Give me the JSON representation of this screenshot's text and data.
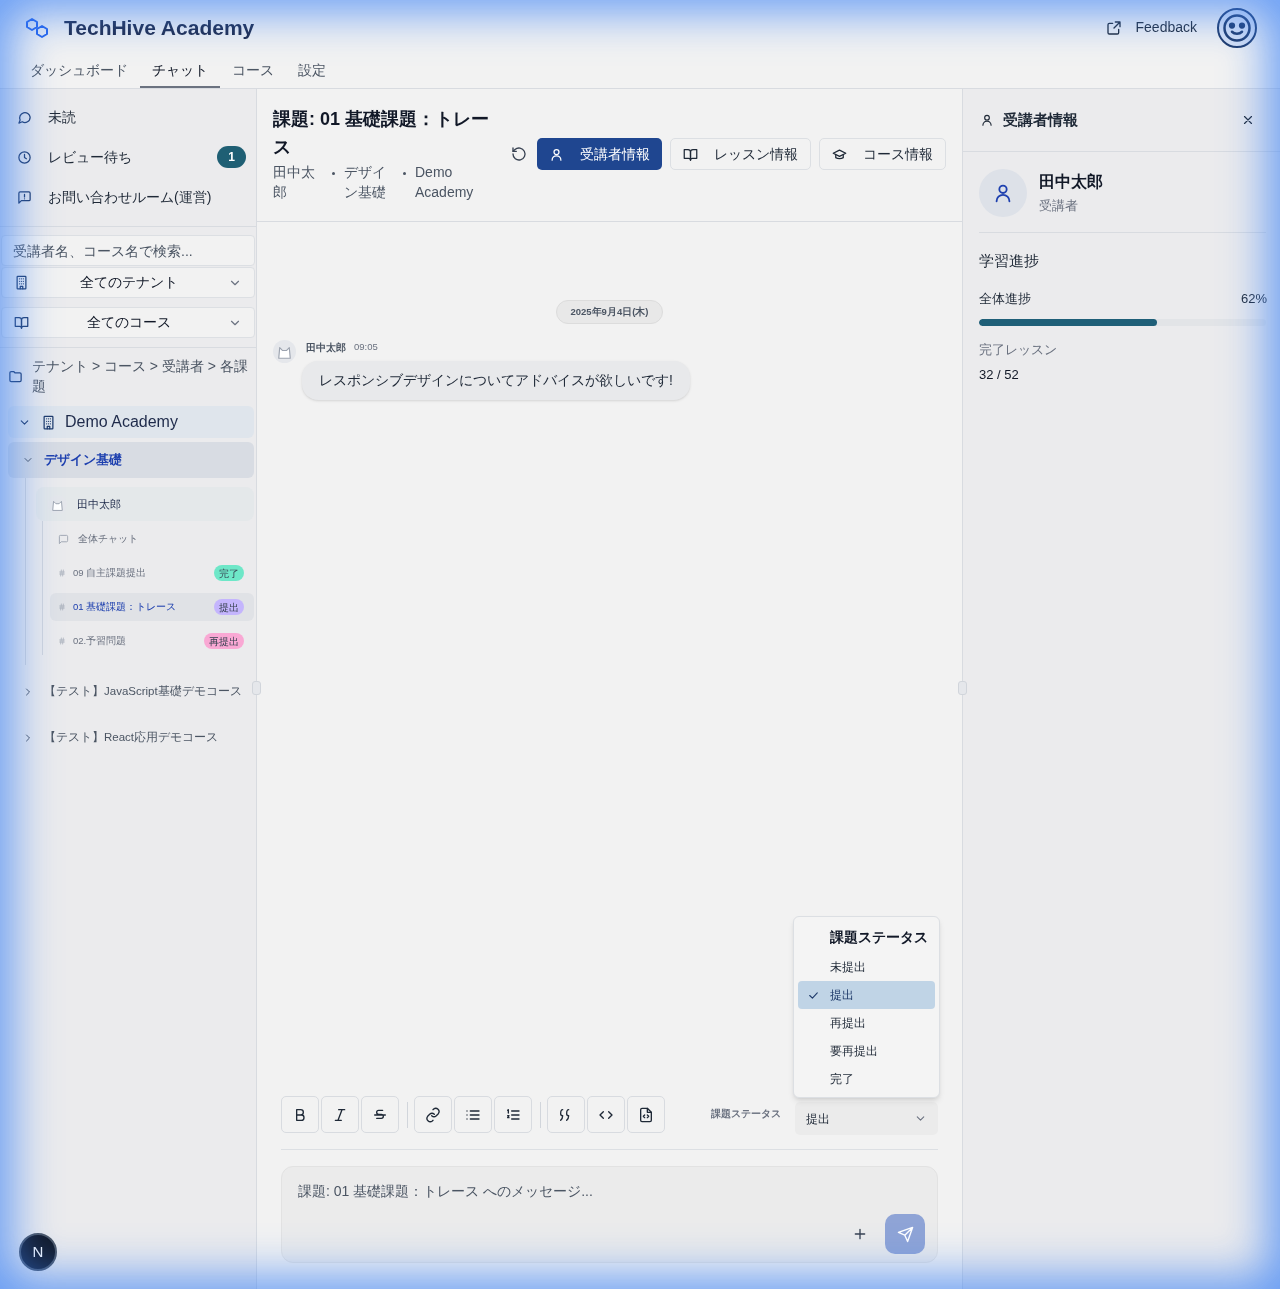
{
  "app": {
    "title": "TechHive Academy",
    "feedback": "Feedback",
    "dev_badge": "N"
  },
  "nav_tabs": [
    {
      "label": "ダッシュボード",
      "selected": false
    },
    {
      "label": "チャット",
      "selected": true
    },
    {
      "label": "コース",
      "selected": false
    },
    {
      "label": "設定",
      "selected": false
    }
  ],
  "sidebar": {
    "quick_links": [
      {
        "kind": "unread",
        "label": "未読"
      },
      {
        "kind": "review",
        "label": "レビュー待ち",
        "badge": "1"
      },
      {
        "kind": "inquiry",
        "label": "お問い合わせルーム(運営)"
      }
    ],
    "search": {
      "placeholder": "受講者名、コース名で検索..."
    },
    "filters": [
      {
        "kind": "tenant",
        "value": "全てのテナント"
      },
      {
        "kind": "course",
        "value": "全てのコース"
      }
    ],
    "tree_caption": "テナント > コース > 受講者 > 各課題",
    "tree": [
      {
        "label": "Demo Academy",
        "expanded": true,
        "children": [
          {
            "label": "デザイン基礎",
            "expanded": true,
            "selected": true,
            "children": [
              {
                "label": "田中太郎",
                "children": [
                  {
                    "kind": "chat",
                    "label": "全体チャット",
                    "selected": false
                  },
                  {
                    "kind": "assignment",
                    "label": "09 自主課題提出",
                    "status": "完了",
                    "color": "#6ee7c8",
                    "selected": false
                  },
                  {
                    "kind": "assignment",
                    "label": "01 基礎課題：トレース",
                    "status": "提出",
                    "color": "#c4b5fd",
                    "selected": true
                  },
                  {
                    "kind": "assignment",
                    "label": "02.予習問題",
                    "status": "再提出",
                    "color": "#f9a8d4",
                    "selected": false
                  }
                ]
              }
            ]
          },
          {
            "label": "【テスト】JavaScript基礎デモコース",
            "expanded": false,
            "selected": false
          },
          {
            "label": "【テスト】React応用デモコース",
            "expanded": false,
            "selected": false
          }
        ]
      }
    ]
  },
  "chat": {
    "title": "課題: 01 基礎課題：トレース",
    "meta": [
      "田中太郎",
      "デザイン基礎",
      "Demo Academy"
    ],
    "actions": [
      {
        "kind": "student",
        "label": "受講者情報",
        "selected": true
      },
      {
        "kind": "lesson",
        "label": "レッスン情報",
        "selected": false
      },
      {
        "kind": "course",
        "label": "コース情報",
        "selected": false
      }
    ],
    "date_divider": "2025年9月4日(木)",
    "messages": [
      {
        "author": "田中太郎",
        "time": "09:05",
        "text": "レスポンシブデザインについてアドバイスが欲しいです!"
      }
    ],
    "status_menu": {
      "title": "課題ステータス",
      "options": [
        {
          "label": "未提出",
          "selected": false
        },
        {
          "label": "提出",
          "selected": true
        },
        {
          "label": "再提出",
          "selected": false
        },
        {
          "label": "要再提出",
          "selected": false
        },
        {
          "label": "完了",
          "selected": false
        }
      ]
    },
    "composer": {
      "status_label": "課題ステータス",
      "status_value": "提出",
      "placeholder": "課題: 01 基礎課題：トレース へのメッセージ..."
    }
  },
  "student_panel": {
    "title": "受講者情報",
    "name": "田中太郎",
    "role": "受講者",
    "section": "学習進捗",
    "progress": {
      "label": "全体進捗",
      "reading": "62%",
      "level": 0.62
    },
    "completed_label": "完了レッスン",
    "completed_value": "32 / 52"
  }
}
